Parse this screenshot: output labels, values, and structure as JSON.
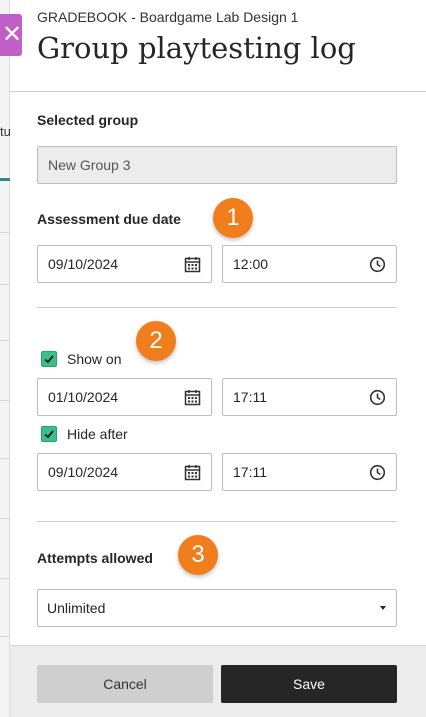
{
  "header": {
    "breadcrumb": "GRADEBOOK - Boardgame Lab Design 1",
    "title": "Group playtesting log"
  },
  "background": {
    "partial_text": "tu"
  },
  "selected_group": {
    "label": "Selected group",
    "value": "New Group 3"
  },
  "due_date": {
    "label": "Assessment due date",
    "date": "09/10/2024",
    "time": "12:00"
  },
  "show_on": {
    "label": "Show on",
    "checked": true,
    "date": "01/10/2024",
    "time": "17:11"
  },
  "hide_after": {
    "label": "Hide after",
    "checked": true,
    "date": "09/10/2024",
    "time": "17:11"
  },
  "attempts": {
    "label": "Attempts allowed",
    "selected": "Unlimited"
  },
  "badges": [
    "1",
    "2",
    "3"
  ],
  "footer": {
    "cancel_label": "Cancel",
    "save_label": "Save"
  },
  "colors": {
    "close_button": "#c060c7",
    "badge": "#f07e1c",
    "checkbox": "#3bbf8a",
    "save_button": "#262626"
  }
}
